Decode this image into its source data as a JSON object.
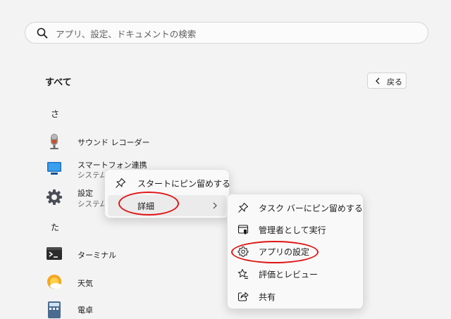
{
  "search": {
    "placeholder": "アプリ、設定、ドキュメントの検索"
  },
  "all_apps": {
    "title": "すべて",
    "back_label": "戻る"
  },
  "groups": [
    {
      "letter": "さ"
    },
    {
      "letter": "た"
    }
  ],
  "apps": [
    {
      "name": "サウンド レコーダー",
      "subtitle": "",
      "icon": "sound-recorder-icon"
    },
    {
      "name": "スマートフォン連携",
      "subtitle": "システム",
      "icon": "phone-link-icon"
    },
    {
      "name": "設定",
      "subtitle": "システム",
      "icon": "settings-gear-icon"
    },
    {
      "name": "ターミナル",
      "subtitle": "",
      "icon": "terminal-icon"
    },
    {
      "name": "天気",
      "subtitle": "",
      "icon": "weather-icon"
    },
    {
      "name": "電卓",
      "subtitle": "",
      "icon": "calculator-icon"
    }
  ],
  "context_menu": {
    "items": [
      {
        "label": "スタートにピン留めする",
        "icon": "pin-icon"
      },
      {
        "label": "詳細",
        "icon": "",
        "has_submenu": true
      }
    ]
  },
  "submenu": {
    "items": [
      {
        "label": "タスク バーにピン留めする",
        "icon": "pin-icon"
      },
      {
        "label": "管理者として実行",
        "icon": "admin-shield-icon"
      },
      {
        "label": "アプリの設定",
        "icon": "gear-icon"
      },
      {
        "label": "評価とレビュー",
        "icon": "star-review-icon"
      },
      {
        "label": "共有",
        "icon": "share-icon"
      }
    ]
  },
  "colors": {
    "background": "#f3f3f3",
    "menu_background": "#f9f9f9",
    "hover": "#ebebeb",
    "highlight_ellipse": "#e01515"
  }
}
